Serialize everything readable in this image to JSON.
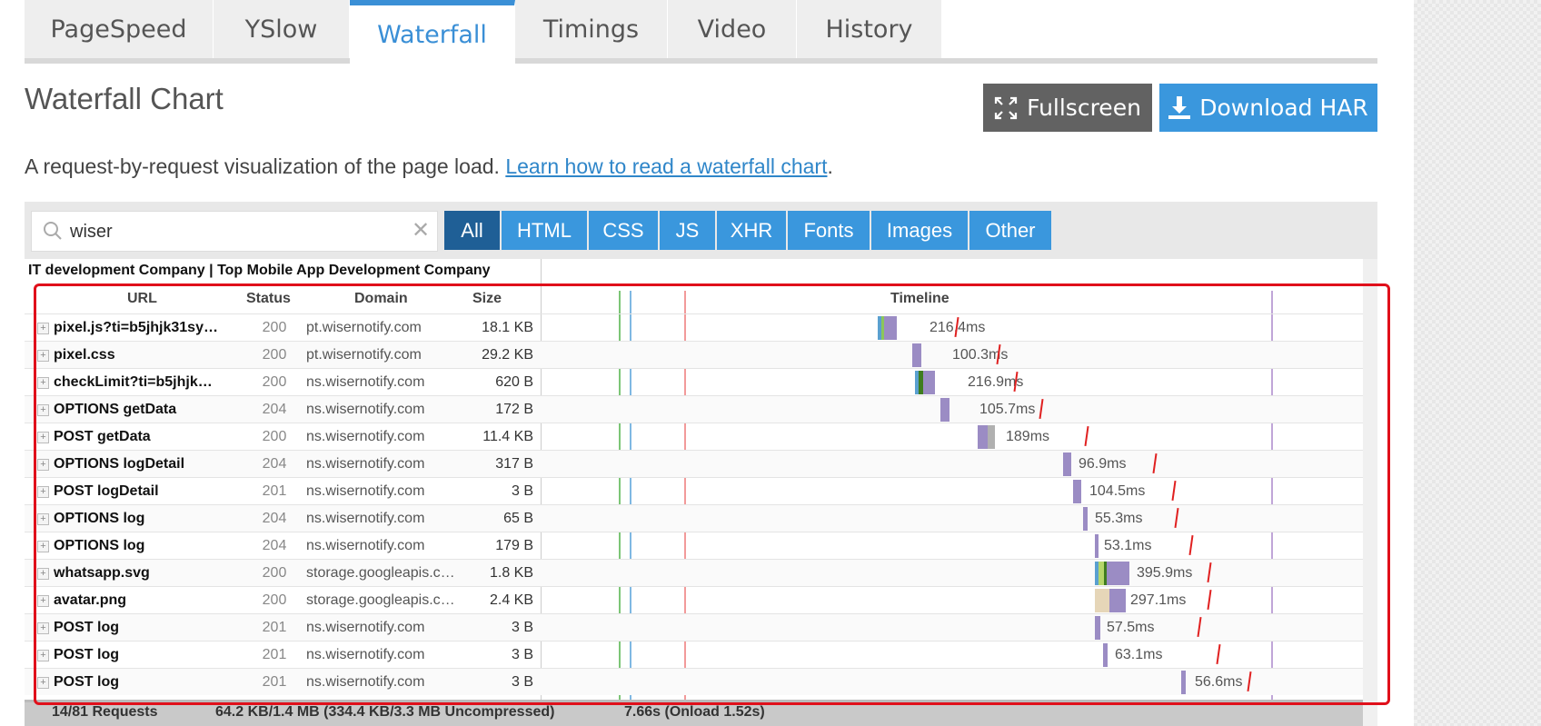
{
  "tabs": [
    {
      "label": "PageSpeed"
    },
    {
      "label": "YSlow"
    },
    {
      "label": "Waterfall",
      "active": true
    },
    {
      "label": "Timings"
    },
    {
      "label": "Video"
    },
    {
      "label": "History"
    }
  ],
  "header": {
    "title": "Waterfall Chart",
    "fullscreen_label": "Fullscreen",
    "download_label": "Download HAR"
  },
  "description": {
    "text": "A request-by-request visualization of the page load. ",
    "link": "Learn how to read a waterfall chart",
    "suffix": "."
  },
  "search": {
    "value": "wiser"
  },
  "filters": [
    "All",
    "HTML",
    "CSS",
    "JS",
    "XHR",
    "Fonts",
    "Images",
    "Other"
  ],
  "table": {
    "page_label": "IT development Company | Top Mobile App Development Company",
    "headers": {
      "url": "URL",
      "status": "Status",
      "domain": "Domain",
      "size": "Size",
      "timeline": "Timeline"
    },
    "rows": [
      {
        "url": "pixel.js?ti=b5jhjk31sy…",
        "status": "200",
        "domain": "pt.wisernotify.com",
        "size": "18.1 KB",
        "time": "216.4ms"
      },
      {
        "url": "pixel.css",
        "status": "200",
        "domain": "pt.wisernotify.com",
        "size": "29.2 KB",
        "time": "100.3ms"
      },
      {
        "url": "checkLimit?ti=b5jhjk…",
        "status": "200",
        "domain": "ns.wisernotify.com",
        "size": "620 B",
        "time": "216.9ms"
      },
      {
        "url": "OPTIONS getData",
        "status": "204",
        "domain": "ns.wisernotify.com",
        "size": "172 B",
        "time": "105.7ms"
      },
      {
        "url": "POST getData",
        "status": "200",
        "domain": "ns.wisernotify.com",
        "size": "11.4 KB",
        "time": "189ms"
      },
      {
        "url": "OPTIONS logDetail",
        "status": "204",
        "domain": "ns.wisernotify.com",
        "size": "317 B",
        "time": "96.9ms"
      },
      {
        "url": "POST logDetail",
        "status": "201",
        "domain": "ns.wisernotify.com",
        "size": "3 B",
        "time": "104.5ms"
      },
      {
        "url": "OPTIONS log",
        "status": "204",
        "domain": "ns.wisernotify.com",
        "size": "65 B",
        "time": "55.3ms"
      },
      {
        "url": "OPTIONS log",
        "status": "204",
        "domain": "ns.wisernotify.com",
        "size": "179 B",
        "time": "53.1ms"
      },
      {
        "url": "whatsapp.svg",
        "status": "200",
        "domain": "storage.googleapis.c…",
        "size": "1.8 KB",
        "time": "395.9ms"
      },
      {
        "url": "avatar.png",
        "status": "200",
        "domain": "storage.googleapis.c…",
        "size": "2.4 KB",
        "time": "297.1ms"
      },
      {
        "url": "POST log",
        "status": "201",
        "domain": "ns.wisernotify.com",
        "size": "3 B",
        "time": "57.5ms"
      },
      {
        "url": "POST log",
        "status": "201",
        "domain": "ns.wisernotify.com",
        "size": "3 B",
        "time": "63.1ms"
      },
      {
        "url": "POST log",
        "status": "201",
        "domain": "ns.wisernotify.com",
        "size": "3 B",
        "time": "56.6ms"
      }
    ]
  },
  "summary": {
    "requests": "14/81 Requests",
    "size": "64.2 KB/1.4 MB  (334.4 KB/3.3 MB Uncompressed)",
    "time": "7.66s  (Onload 1.52s)"
  },
  "colors": {
    "accent": "#3a97dd",
    "bar": "#9b8cc4",
    "highlight": "#e0101b"
  }
}
